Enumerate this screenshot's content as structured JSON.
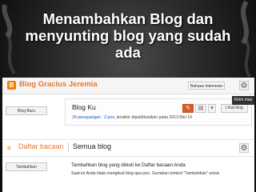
{
  "slide": {
    "title_line1": "Menambahkan Blog dan",
    "title_line2": "menyunting blog yang sudah",
    "title_line3": "ada"
  },
  "header": {
    "logo_letter": "B",
    "blog_title": "Blog Gracius Jeremia",
    "language": "Bahasa Indonesia ▾",
    "gear": "⚙"
  },
  "sidebar": {
    "new_blog_label": "Blog Baru",
    "add_label": "Tambahkan"
  },
  "blog": {
    "name": "Blog Ku",
    "views": "24 penayangan",
    "posts": "2 pos,",
    "last_published": "terakhir dipublikasikan pada 2013 Mei 14",
    "view_blog_label": "Lihat blog",
    "tools": [
      "✎",
      "▤",
      "▾"
    ]
  },
  "reading_list": {
    "rss": "≈",
    "title": "Daftar bacaan",
    "all_blogs": "Semua blog",
    "gear": "⚙",
    "follow_heading": "Tambahkan blog yang diikuti ke Daftar bacaan Anda",
    "follow_text": "Saat ini Anda tidak mengikuti blog apa pun. Gunakan tombol \"Tambahkan\" untuk"
  },
  "side_tab": {
    "label": "Kirim mas"
  },
  "colors": {
    "accent": "#e8782a",
    "link": "#1155cc",
    "primary_button": "#d95d2b"
  }
}
